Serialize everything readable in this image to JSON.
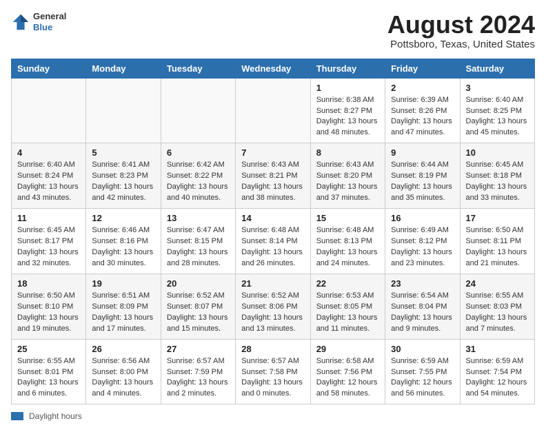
{
  "header": {
    "logo_general": "General",
    "logo_blue": "Blue",
    "title": "August 2024",
    "location": "Pottsboro, Texas, United States"
  },
  "weekdays": [
    "Sunday",
    "Monday",
    "Tuesday",
    "Wednesday",
    "Thursday",
    "Friday",
    "Saturday"
  ],
  "weeks": [
    [
      {
        "day": "",
        "info": ""
      },
      {
        "day": "",
        "info": ""
      },
      {
        "day": "",
        "info": ""
      },
      {
        "day": "",
        "info": ""
      },
      {
        "day": "1",
        "info": "Sunrise: 6:38 AM\nSunset: 8:27 PM\nDaylight: 13 hours and 48 minutes."
      },
      {
        "day": "2",
        "info": "Sunrise: 6:39 AM\nSunset: 8:26 PM\nDaylight: 13 hours and 47 minutes."
      },
      {
        "day": "3",
        "info": "Sunrise: 6:40 AM\nSunset: 8:25 PM\nDaylight: 13 hours and 45 minutes."
      }
    ],
    [
      {
        "day": "4",
        "info": "Sunrise: 6:40 AM\nSunset: 8:24 PM\nDaylight: 13 hours and 43 minutes."
      },
      {
        "day": "5",
        "info": "Sunrise: 6:41 AM\nSunset: 8:23 PM\nDaylight: 13 hours and 42 minutes."
      },
      {
        "day": "6",
        "info": "Sunrise: 6:42 AM\nSunset: 8:22 PM\nDaylight: 13 hours and 40 minutes."
      },
      {
        "day": "7",
        "info": "Sunrise: 6:43 AM\nSunset: 8:21 PM\nDaylight: 13 hours and 38 minutes."
      },
      {
        "day": "8",
        "info": "Sunrise: 6:43 AM\nSunset: 8:20 PM\nDaylight: 13 hours and 37 minutes."
      },
      {
        "day": "9",
        "info": "Sunrise: 6:44 AM\nSunset: 8:19 PM\nDaylight: 13 hours and 35 minutes."
      },
      {
        "day": "10",
        "info": "Sunrise: 6:45 AM\nSunset: 8:18 PM\nDaylight: 13 hours and 33 minutes."
      }
    ],
    [
      {
        "day": "11",
        "info": "Sunrise: 6:45 AM\nSunset: 8:17 PM\nDaylight: 13 hours and 32 minutes."
      },
      {
        "day": "12",
        "info": "Sunrise: 6:46 AM\nSunset: 8:16 PM\nDaylight: 13 hours and 30 minutes."
      },
      {
        "day": "13",
        "info": "Sunrise: 6:47 AM\nSunset: 8:15 PM\nDaylight: 13 hours and 28 minutes."
      },
      {
        "day": "14",
        "info": "Sunrise: 6:48 AM\nSunset: 8:14 PM\nDaylight: 13 hours and 26 minutes."
      },
      {
        "day": "15",
        "info": "Sunrise: 6:48 AM\nSunset: 8:13 PM\nDaylight: 13 hours and 24 minutes."
      },
      {
        "day": "16",
        "info": "Sunrise: 6:49 AM\nSunset: 8:12 PM\nDaylight: 13 hours and 23 minutes."
      },
      {
        "day": "17",
        "info": "Sunrise: 6:50 AM\nSunset: 8:11 PM\nDaylight: 13 hours and 21 minutes."
      }
    ],
    [
      {
        "day": "18",
        "info": "Sunrise: 6:50 AM\nSunset: 8:10 PM\nDaylight: 13 hours and 19 minutes."
      },
      {
        "day": "19",
        "info": "Sunrise: 6:51 AM\nSunset: 8:09 PM\nDaylight: 13 hours and 17 minutes."
      },
      {
        "day": "20",
        "info": "Sunrise: 6:52 AM\nSunset: 8:07 PM\nDaylight: 13 hours and 15 minutes."
      },
      {
        "day": "21",
        "info": "Sunrise: 6:52 AM\nSunset: 8:06 PM\nDaylight: 13 hours and 13 minutes."
      },
      {
        "day": "22",
        "info": "Sunrise: 6:53 AM\nSunset: 8:05 PM\nDaylight: 13 hours and 11 minutes."
      },
      {
        "day": "23",
        "info": "Sunrise: 6:54 AM\nSunset: 8:04 PM\nDaylight: 13 hours and 9 minutes."
      },
      {
        "day": "24",
        "info": "Sunrise: 6:55 AM\nSunset: 8:03 PM\nDaylight: 13 hours and 7 minutes."
      }
    ],
    [
      {
        "day": "25",
        "info": "Sunrise: 6:55 AM\nSunset: 8:01 PM\nDaylight: 13 hours and 6 minutes."
      },
      {
        "day": "26",
        "info": "Sunrise: 6:56 AM\nSunset: 8:00 PM\nDaylight: 13 hours and 4 minutes."
      },
      {
        "day": "27",
        "info": "Sunrise: 6:57 AM\nSunset: 7:59 PM\nDaylight: 13 hours and 2 minutes."
      },
      {
        "day": "28",
        "info": "Sunrise: 6:57 AM\nSunset: 7:58 PM\nDaylight: 13 hours and 0 minutes."
      },
      {
        "day": "29",
        "info": "Sunrise: 6:58 AM\nSunset: 7:56 PM\nDaylight: 12 hours and 58 minutes."
      },
      {
        "day": "30",
        "info": "Sunrise: 6:59 AM\nSunset: 7:55 PM\nDaylight: 12 hours and 56 minutes."
      },
      {
        "day": "31",
        "info": "Sunrise: 6:59 AM\nSunset: 7:54 PM\nDaylight: 12 hours and 54 minutes."
      }
    ]
  ],
  "legend": {
    "label": "Daylight hours"
  }
}
